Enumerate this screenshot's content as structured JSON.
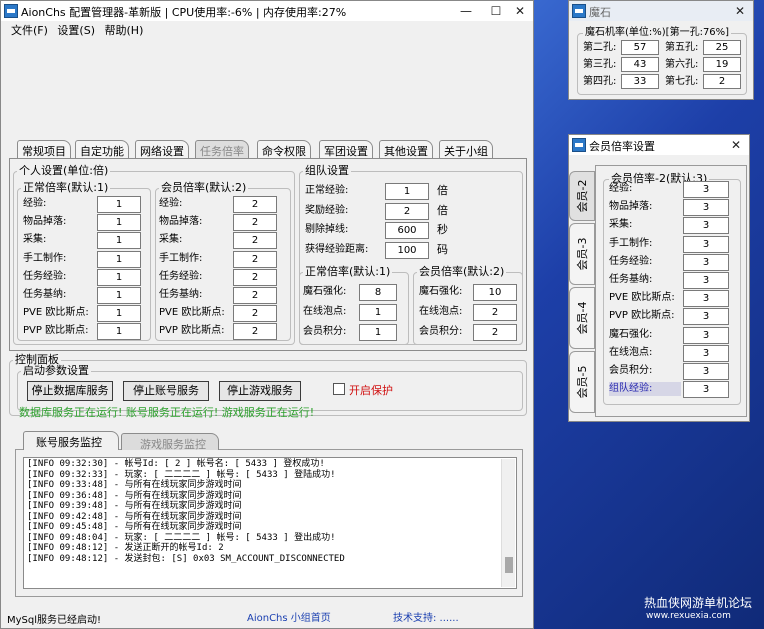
{
  "main": {
    "title": "AionChs 配置管理器-革新版 | CPU使用率:-6% | 内存使用率:27%",
    "menu": [
      "文件(F)",
      "设置(S)",
      "帮助(H)"
    ],
    "tabs": [
      "常规项目",
      "自定功能",
      "网络设置",
      "任务倍率",
      "命令权限",
      "军团设置",
      "其他设置",
      "关于小组"
    ],
    "personal_group": "个人设置(单位:倍)",
    "normal_rate": {
      "title": "正常倍率(默认:1)",
      "rows": [
        {
          "label": "经验:",
          "value": "1"
        },
        {
          "label": "物品掉落:",
          "value": "1"
        },
        {
          "label": "采集:",
          "value": "1"
        },
        {
          "label": "手工制作:",
          "value": "1"
        },
        {
          "label": "任务经验:",
          "value": "1"
        },
        {
          "label": "任务基纳:",
          "value": "1"
        },
        {
          "label": "PVE 欧比斯点:",
          "value": "1"
        },
        {
          "label": "PVP 欧比斯点:",
          "value": "1"
        }
      ]
    },
    "member_rate": {
      "title": "会员倍率(默认:2)",
      "rows": [
        {
          "label": "经验:",
          "value": "2"
        },
        {
          "label": "物品掉落:",
          "value": "2"
        },
        {
          "label": "采集:",
          "value": "2"
        },
        {
          "label": "手工制作:",
          "value": "2"
        },
        {
          "label": "任务经验:",
          "value": "2"
        },
        {
          "label": "任务基纳:",
          "value": "2"
        },
        {
          "label": "PVE 欧比斯点:",
          "value": "2"
        },
        {
          "label": "PVP 欧比斯点:",
          "value": "2"
        }
      ]
    },
    "team": {
      "title": "组队设置",
      "rows": [
        {
          "label": "正常经验:",
          "value": "1",
          "unit": "倍"
        },
        {
          "label": "奖励经验:",
          "value": "2",
          "unit": "倍"
        },
        {
          "label": "剔除掉线:",
          "value": "600",
          "unit": "秒"
        },
        {
          "label": "获得经验距离:",
          "value": "100",
          "unit": "码"
        }
      ]
    },
    "team_normal": {
      "title": "正常倍率(默认:1)",
      "rows": [
        {
          "label": "魔石强化:",
          "value": "8"
        },
        {
          "label": "在线泡点:",
          "value": "1"
        },
        {
          "label": "会员积分:",
          "value": "1"
        }
      ]
    },
    "team_member": {
      "title": "会员倍率(默认:2)",
      "rows": [
        {
          "label": "魔石强化:",
          "value": "10"
        },
        {
          "label": "在线泡点:",
          "value": "2"
        },
        {
          "label": "会员积分:",
          "value": "2"
        }
      ]
    },
    "control": {
      "title": "控制面板",
      "sub": "启动参数设置",
      "btn1": "停止数据库服务",
      "btn2": "停止账号服务",
      "btn3": "停止游戏服务",
      "protect": "开启保护",
      "status": "数据库服务正在运行! 账号服务正在运行! 游戏服务正在运行!"
    },
    "monitor_tabs": [
      "账号服务监控",
      "游戏服务监控"
    ],
    "log": [
      "[INFO 09:32:30] - 帐号Id: [ 2 ] 帐号名: [ 5433 ] 登权成功!",
      "[INFO 09:32:33] - 玩家: [ 二二二二 ] 帐号: [ 5433 ] 登陆成功!",
      "[INFO 09:33:48] - 与所有在线玩家同步游戏时间",
      "[INFO 09:36:48] - 与所有在线玩家同步游戏时间",
      "[INFO 09:39:48] - 与所有在线玩家同步游戏时间",
      "[INFO 09:42:48] - 与所有在线玩家同步游戏时间",
      "[INFO 09:45:48] - 与所有在线玩家同步游戏时间",
      "[INFO 09:48:04] - 玩家: [ 二二二二 ] 帐号: [ 5433 ] 登出成功!",
      "[INFO 09:48:12] - 发送正断开的帐号Id: 2",
      "[INFO 09:48:12] - 发送封包: [S] 0x03 SM_ACCOUNT_DISCONNECTED"
    ],
    "footer": {
      "left": "MySql服务已经启动!",
      "center": "AionChs 小组首页",
      "right": "技术支持: ......"
    }
  },
  "magic": {
    "title": "魔石",
    "group": "魔石机率(单位:%)[第一孔:76%]",
    "rows": [
      {
        "l1": "第二孔:",
        "v1": "57",
        "l2": "第五孔:",
        "v2": "25"
      },
      {
        "l1": "第三孔:",
        "v1": "43",
        "l2": "第六孔:",
        "v2": "19"
      },
      {
        "l1": "第四孔:",
        "v1": "33",
        "l2": "第七孔:",
        "v2": "2"
      }
    ]
  },
  "member": {
    "title": "会员倍率设置",
    "vtabs": [
      "会员-2",
      "会员-3",
      "会员-4",
      "会员-5"
    ],
    "group": "会员倍率-2(默认:3)",
    "rows": [
      {
        "label": "经验:",
        "value": "3"
      },
      {
        "label": "物品掉落:",
        "value": "3"
      },
      {
        "label": "采集:",
        "value": "3"
      },
      {
        "label": "手工制作:",
        "value": "3"
      },
      {
        "label": "任务经验:",
        "value": "3"
      },
      {
        "label": "任务基纳:",
        "value": "3"
      },
      {
        "label": "PVE 欧比斯点:",
        "value": "3"
      },
      {
        "label": "PVP 欧比斯点:",
        "value": "3"
      },
      {
        "label": "魔石强化:",
        "value": "3"
      },
      {
        "label": "在线泡点:",
        "value": "3"
      },
      {
        "label": "会员积分:",
        "value": "3"
      },
      {
        "label": "组队经验:",
        "value": "3"
      }
    ]
  },
  "watermark": {
    "line1": "热血侠网游单机论坛",
    "line2": "www.rexuexia.com"
  }
}
